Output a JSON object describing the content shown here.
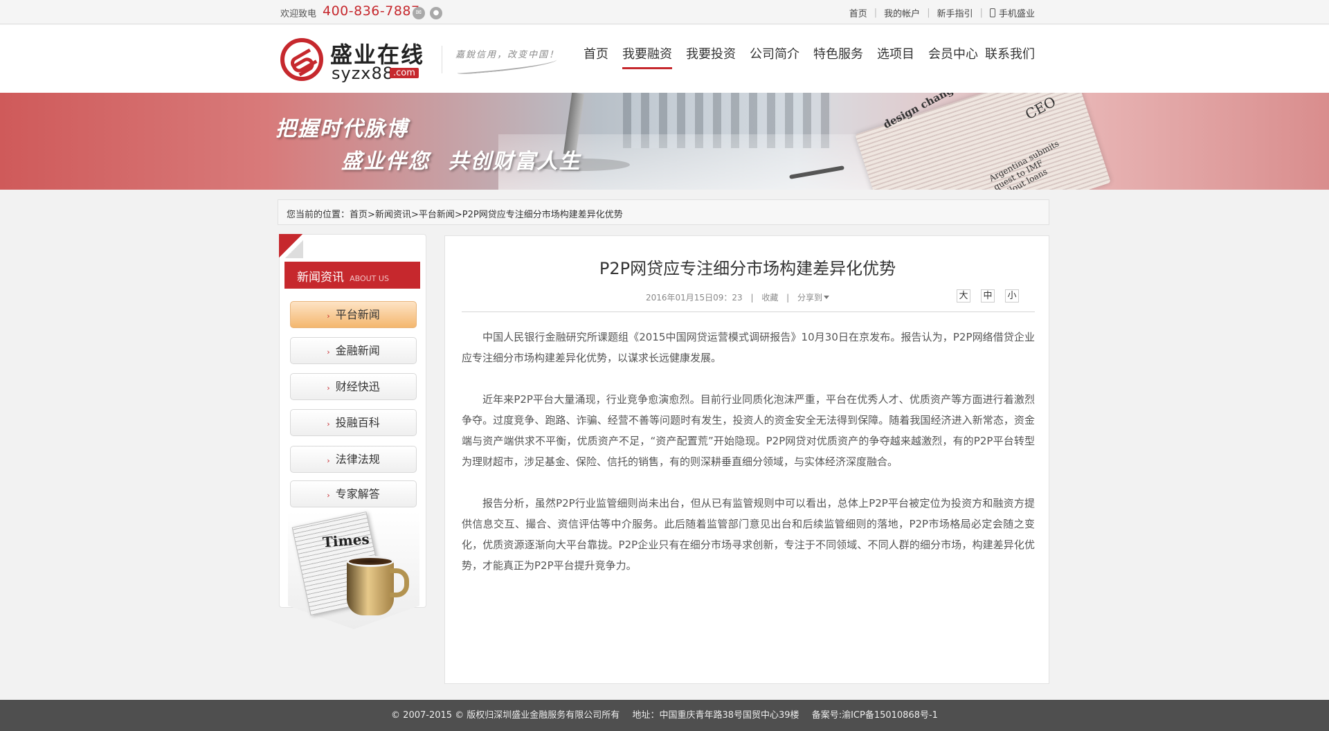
{
  "topbar": {
    "welcome": "欢迎致电",
    "phone": "400-836-7887",
    "links": [
      "首页",
      "我的帐户",
      "新手指引",
      "手机盛业"
    ]
  },
  "logo": {
    "cn": "盛业在线",
    "en": "syzx88",
    "com": ".com"
  },
  "slogan": "嘉銳信用，改变中国！",
  "nav": {
    "items": [
      "首页",
      "我要融资",
      "我要投资",
      "公司简介",
      "特色服务",
      "选项目",
      "会员中心",
      "联系我们"
    ],
    "active": "我要融资"
  },
  "banner": {
    "line1": "把握时代脉博",
    "line2": "盛业伴您 共创财富人生",
    "newspaper_text_1": "design change",
    "newspaper_text_2": "CEO",
    "newspaper_text_3": "Argentina submits\nquest to IMF\nbailout loans"
  },
  "breadcrumb": {
    "prefix": "您当前的位置：",
    "items": [
      "首页",
      "新闻资讯",
      "平台新闻",
      "P2P网贷应专注细分市场构建差异化优势"
    ],
    "sep": ">"
  },
  "sidebar": {
    "title_cn": "新闻资讯",
    "title_en": "ABOUT US",
    "items": [
      "平台新闻",
      "金融新闻",
      "财经快迅",
      "投融百科",
      "法律法规",
      "专家解答"
    ],
    "active_index": 0,
    "promo_text": "Times"
  },
  "article": {
    "title": "P2P网贷应专注细分市场构建差异化优势",
    "date": "2016年01月15日09：23",
    "collect": "收藏",
    "share": "分享到",
    "font_sizes": [
      "大",
      "中",
      "小"
    ],
    "paragraphs": [
      "中国人民银行金融研究所课题组《2015中国网贷运营模式调研报告》10月30日在京发布。报告认为，P2P网络借贷企业应专注细分市场构建差异化优势，以谋求长远健康发展。",
      "近年来P2P平台大量涌现，行业竞争愈演愈烈。目前行业同质化泡沫严重，平台在优秀人才、优质资产等方面进行着激烈争夺。过度竞争、跑路、诈骗、经营不善等问题时有发生，投资人的资金安全无法得到保障。随着我国经济进入新常态，资金端与资产端供求不平衡，优质资产不足，“资产配置荒”开始隐现。P2P网贷对优质资产的争夺越来越激烈，有的P2P平台转型为理财超市，涉足基金、保险、信托的销售，有的则深耕垂直细分领域，与实体经济深度融合。",
      "报告分析，虽然P2P行业监管细则尚未出台，但从已有监管规则中可以看出，总体上P2P平台被定位为投资方和融资方提供信息交互、撮合、资信评估等中介服务。此后随着监管部门意见出台和后续监管细则的落地，P2P市场格局必定会随之变化，优质资源逐渐向大平台靠拢。P2P企业只有在细分市场寻求创新，专注于不同领域、不同人群的细分市场，构建差异化优势，才能真正为P2P平台提升竞争力。"
    ]
  },
  "footer": {
    "copyright": "© 2007-2015 © 版权归深圳盛业金融服务有限公司所有",
    "address": "地址：中国重庆青年路38号国贸中心39楼",
    "icp": "备案号:渝ICP备15010868号-1"
  },
  "colors": {
    "brand_red": "#c6282d",
    "active_orange": "#f4b76e",
    "footer_bg": "#4f4f4f"
  }
}
